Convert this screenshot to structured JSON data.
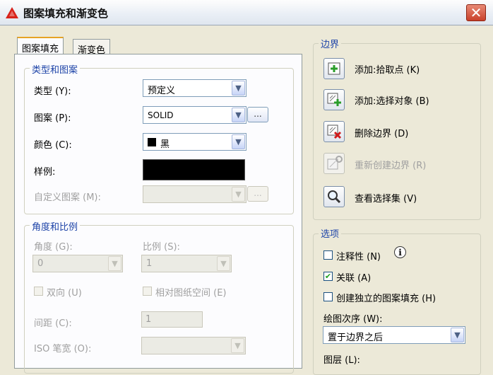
{
  "window": {
    "title": "图案填充和渐变色",
    "close_symbol": "✕"
  },
  "tabs": [
    {
      "label": "图案填充"
    },
    {
      "label": "渐变色"
    }
  ],
  "type_pattern": {
    "legend": "类型和图案",
    "type_label": "类型 (Y):",
    "type_value": "预定义",
    "pattern_label": "图案 (P):",
    "pattern_value": "SOLID",
    "color_label": "颜色 (C):",
    "color_value": "黑",
    "swatch_color": "#000000",
    "sample_label": "样例:",
    "custom_label": "自定义图案 (M):",
    "browse_label": "..."
  },
  "angle_scale": {
    "legend": "角度和比例",
    "angle_label": "角度 (G):",
    "angle_value": "0",
    "scale_label": "比例 (S):",
    "scale_value": "1",
    "double_label": "双向 (U)",
    "relative_label": "相对图纸空间 (E)",
    "spacing_label": "间距 (C):",
    "spacing_value": "1",
    "iso_label": "ISO 笔宽 (O):"
  },
  "boundary": {
    "legend": "边界",
    "add_pick": "添加:拾取点 (K)",
    "add_select": "添加:选择对象 (B)",
    "remove": "删除边界 (D)",
    "recreate": "重新创建边界 (R)",
    "view": "查看选择集 (V)"
  },
  "options": {
    "legend": "选项",
    "annotative": "注释性 (N)",
    "associative": "关联 (A)",
    "associative_checked": true,
    "independent": "创建独立的图案填充 (H)",
    "draw_order_label": "绘图次序 (W):",
    "draw_order_value": "置于边界之后",
    "layer_label": "图层 (L):"
  },
  "icons": {
    "dropdown": "▼",
    "check": "✔",
    "info": "i"
  },
  "colors": {
    "accent_tab": "#e6a325",
    "swatch": "#000000"
  }
}
